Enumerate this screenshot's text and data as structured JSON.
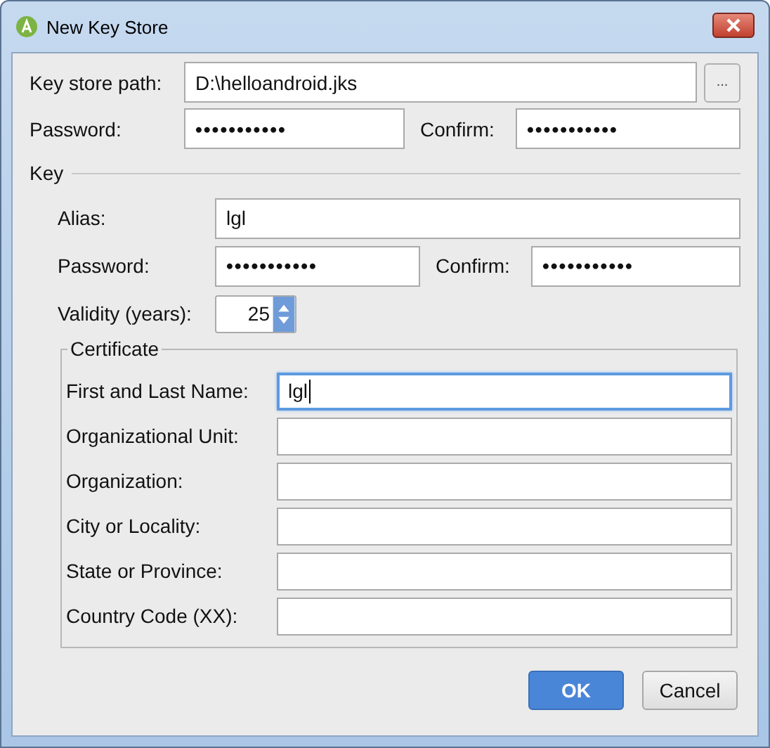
{
  "window": {
    "title": "New Key Store"
  },
  "keystore": {
    "path_label": "Key store path:",
    "path": "D:\\helloandroid.jks",
    "browse": "...",
    "password_label": "Password:",
    "password": "•••••••••••",
    "confirm_label": "Confirm:",
    "confirm": "•••••••••••"
  },
  "key": {
    "title": "Key",
    "alias_label": "Alias:",
    "alias": "lgl",
    "password_label": "Password:",
    "password": "•••••••••••",
    "confirm_label": "Confirm:",
    "confirm": "•••••••••••",
    "validity_label": "Validity (years):",
    "validity": "25",
    "certificate": {
      "title": "Certificate",
      "fields": [
        {
          "label": "First and Last Name:",
          "value": "lgl",
          "focused": true
        },
        {
          "label": "Organizational Unit:",
          "focused": false
        },
        {
          "label": "Organization:",
          "focused": false
        },
        {
          "label": "City or Locality:",
          "focused": false
        },
        {
          "label": "State or Province:",
          "focused": false
        },
        {
          "label": "Country Code (XX):",
          "focused": false
        }
      ]
    }
  },
  "buttons": [
    {
      "label": "OK",
      "kind": "primary"
    },
    {
      "label": "Cancel",
      "kind": "secondary"
    }
  ]
}
